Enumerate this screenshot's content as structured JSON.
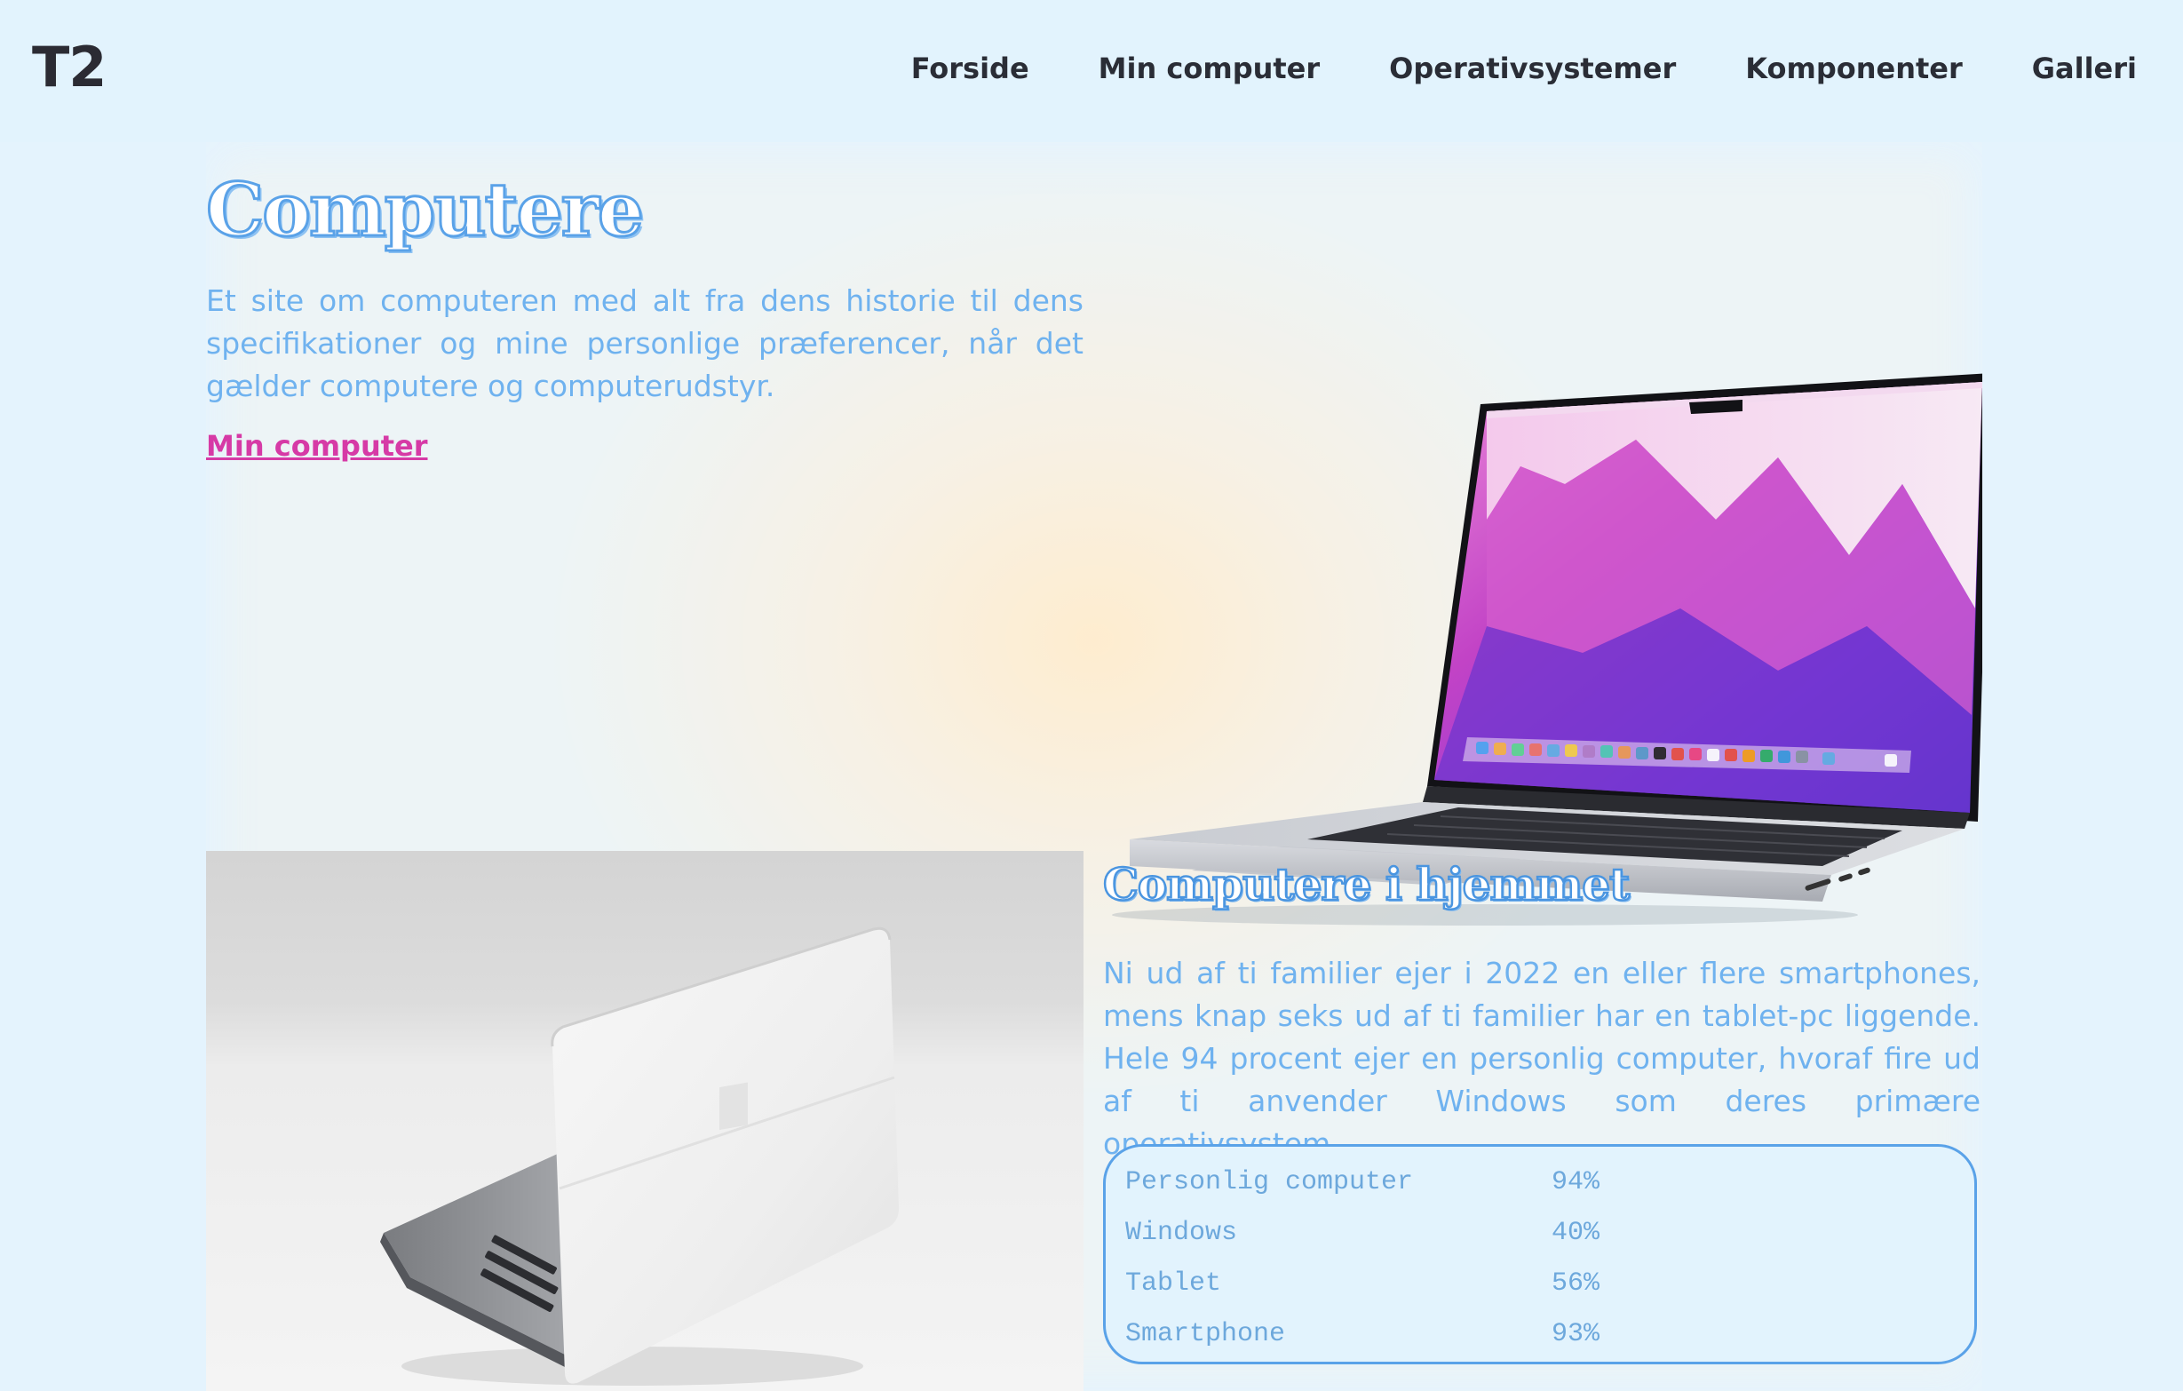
{
  "header": {
    "logo": "T2",
    "nav": [
      "Forside",
      "Min computer",
      "Operativsystemer",
      "Komponenter",
      "Galleri"
    ]
  },
  "hero": {
    "title": "Computere",
    "text": "Et site om computeren med alt fra dens historie til dens specifikationer og mine personlige præferencer, når det gælder computere og computerudstyr.",
    "link": "Min computer"
  },
  "section2": {
    "title": "Computere i hjemmet",
    "text": "Ni ud af ti familier ejer i 2022 en eller flere smartphones, mens knap seks ud af ti familier har en tablet-pc liggende. Hele 94 procent ejer en personlig computer, hvoraf fire ud af ti anvender Windows som deres primære operativsystem.",
    "stats": [
      {
        "label": "Personlig computer",
        "value": "94%"
      },
      {
        "label": "Windows",
        "value": "40%"
      },
      {
        "label": "Tablet",
        "value": "56%"
      },
      {
        "label": "Smartphone",
        "value": "93%"
      }
    ]
  },
  "colors": {
    "accent_blue": "#5aa2e8",
    "text_blue": "#6fb2ef",
    "link_pink": "#d63aa6",
    "background": "#e4f3fd"
  }
}
